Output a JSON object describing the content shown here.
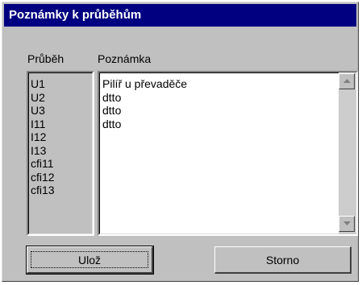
{
  "window": {
    "title": "Poznámky k průběhům"
  },
  "columns": {
    "prubeh": "Průběh",
    "poznamka": "Poznámka"
  },
  "prubeh_items": [
    "U1",
    "U2",
    "U3",
    "I11",
    "I12",
    "I13",
    "cfi11",
    "cfi12",
    "cfi13"
  ],
  "poznamky": [
    "Pilíř u převaděče",
    "dtto",
    "dtto",
    "dtto"
  ],
  "buttons": {
    "save": "Ulož",
    "cancel": "Storno"
  },
  "icons": {
    "scroll_up": "triangle-up-icon",
    "scroll_down": "triangle-down-icon"
  }
}
